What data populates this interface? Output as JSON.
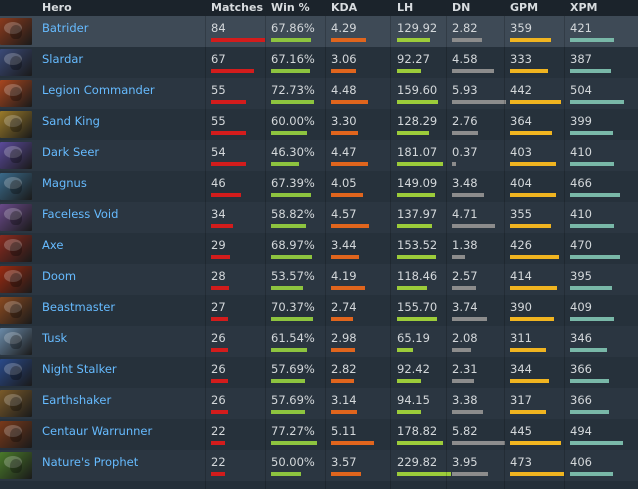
{
  "headers": {
    "hero": "Hero",
    "matches": "Matches",
    "win": "Win %",
    "kda": "KDA",
    "lh": "LH",
    "dn": "DN",
    "gpm": "GPM",
    "xpm": "XPM"
  },
  "colors": {
    "matches_bar": "#d31c1c",
    "win_bar": "#8dc43f",
    "kda_bar": "#e0651d",
    "lh_bar": "#9ccc3a",
    "dn_bar": "#8c8c8c",
    "gpm_bar": "#f0b420",
    "xpm_bar": "#79b8a8",
    "hero_link": "#66bbff"
  },
  "heroes": [
    {
      "name": "Batrider",
      "icon": "batrider-portrait",
      "tint": "#8a3a1c",
      "matches": "84",
      "matches_frac": 1.0,
      "win": "67.86%",
      "win_frac": 0.74,
      "kda": "4.29",
      "kda_frac": 0.64,
      "lh": "129.92",
      "lh_frac": 0.62,
      "dn": "2.82",
      "dn_frac": 0.55,
      "gpm": "359",
      "gpm_frac": 0.76,
      "xpm": "421",
      "xpm_frac": 0.82
    },
    {
      "name": "Slardar",
      "icon": "slardar-portrait",
      "tint": "#3a4a78",
      "matches": "67",
      "matches_frac": 0.8,
      "win": "67.16%",
      "win_frac": 0.73,
      "kda": "3.06",
      "kda_frac": 0.46,
      "lh": "92.27",
      "lh_frac": 0.44,
      "dn": "4.58",
      "dn_frac": 0.78,
      "gpm": "333",
      "gpm_frac": 0.7,
      "xpm": "387",
      "xpm_frac": 0.76
    },
    {
      "name": "Legion Commander",
      "icon": "legion-commander-portrait",
      "tint": "#a8461e",
      "matches": "55",
      "matches_frac": 0.65,
      "win": "72.73%",
      "win_frac": 0.8,
      "kda": "4.48",
      "kda_frac": 0.68,
      "lh": "159.60",
      "lh_frac": 0.76,
      "dn": "5.93",
      "dn_frac": 1.0,
      "gpm": "442",
      "gpm_frac": 0.94,
      "xpm": "504",
      "xpm_frac": 1.0
    },
    {
      "name": "Sand King",
      "icon": "sand-king-portrait",
      "tint": "#9a7a2a",
      "matches": "55",
      "matches_frac": 0.65,
      "win": "60.00%",
      "win_frac": 0.66,
      "kda": "3.30",
      "kda_frac": 0.5,
      "lh": "128.29",
      "lh_frac": 0.6,
      "dn": "2.76",
      "dn_frac": 0.48,
      "gpm": "364",
      "gpm_frac": 0.77,
      "xpm": "399",
      "xpm_frac": 0.79
    },
    {
      "name": "Dark Seer",
      "icon": "dark-seer-portrait",
      "tint": "#5a4a9a",
      "matches": "54",
      "matches_frac": 0.64,
      "win": "46.30%",
      "win_frac": 0.51,
      "kda": "4.47",
      "kda_frac": 0.68,
      "lh": "181.07",
      "lh_frac": 0.86,
      "dn": "0.37",
      "dn_frac": 0.08,
      "gpm": "403",
      "gpm_frac": 0.85,
      "xpm": "410",
      "xpm_frac": 0.81
    },
    {
      "name": "Magnus",
      "icon": "magnus-portrait",
      "tint": "#3a6a8a",
      "matches": "46",
      "matches_frac": 0.55,
      "win": "67.39%",
      "win_frac": 0.74,
      "kda": "4.05",
      "kda_frac": 0.6,
      "lh": "149.09",
      "lh_frac": 0.7,
      "dn": "3.48",
      "dn_frac": 0.6,
      "gpm": "404",
      "gpm_frac": 0.85,
      "xpm": "466",
      "xpm_frac": 0.92
    },
    {
      "name": "Faceless Void",
      "icon": "faceless-void-portrait",
      "tint": "#6a4a8a",
      "matches": "34",
      "matches_frac": 0.4,
      "win": "58.82%",
      "win_frac": 0.65,
      "kda": "4.57",
      "kda_frac": 0.7,
      "lh": "137.97",
      "lh_frac": 0.65,
      "dn": "4.71",
      "dn_frac": 0.8,
      "gpm": "355",
      "gpm_frac": 0.75,
      "xpm": "410",
      "xpm_frac": 0.81
    },
    {
      "name": "Axe",
      "icon": "axe-portrait",
      "tint": "#8a2a1e",
      "matches": "29",
      "matches_frac": 0.35,
      "win": "68.97%",
      "win_frac": 0.76,
      "kda": "3.44",
      "kda_frac": 0.52,
      "lh": "153.52",
      "lh_frac": 0.72,
      "dn": "1.38",
      "dn_frac": 0.24,
      "gpm": "426",
      "gpm_frac": 0.9,
      "xpm": "470",
      "xpm_frac": 0.93
    },
    {
      "name": "Doom",
      "icon": "doom-portrait",
      "tint": "#9a2a10",
      "matches": "28",
      "matches_frac": 0.33,
      "win": "53.57%",
      "win_frac": 0.59,
      "kda": "4.19",
      "kda_frac": 0.63,
      "lh": "118.46",
      "lh_frac": 0.56,
      "dn": "2.57",
      "dn_frac": 0.44,
      "gpm": "414",
      "gpm_frac": 0.87,
      "xpm": "395",
      "xpm_frac": 0.78
    },
    {
      "name": "Beastmaster",
      "icon": "beastmaster-portrait",
      "tint": "#8a4a20",
      "matches": "27",
      "matches_frac": 0.32,
      "win": "70.37%",
      "win_frac": 0.77,
      "kda": "2.74",
      "kda_frac": 0.41,
      "lh": "155.70",
      "lh_frac": 0.74,
      "dn": "3.74",
      "dn_frac": 0.64,
      "gpm": "390",
      "gpm_frac": 0.82,
      "xpm": "409",
      "xpm_frac": 0.81
    },
    {
      "name": "Tusk",
      "icon": "tusk-portrait",
      "tint": "#6a8aa8",
      "matches": "26",
      "matches_frac": 0.31,
      "win": "61.54%",
      "win_frac": 0.67,
      "kda": "2.98",
      "kda_frac": 0.45,
      "lh": "65.19",
      "lh_frac": 0.3,
      "dn": "2.08",
      "dn_frac": 0.36,
      "gpm": "311",
      "gpm_frac": 0.66,
      "xpm": "346",
      "xpm_frac": 0.68
    },
    {
      "name": "Night Stalker",
      "icon": "night-stalker-portrait",
      "tint": "#2a4a8a",
      "matches": "26",
      "matches_frac": 0.31,
      "win": "57.69%",
      "win_frac": 0.63,
      "kda": "2.82",
      "kda_frac": 0.43,
      "lh": "92.42",
      "lh_frac": 0.44,
      "dn": "2.31",
      "dn_frac": 0.4,
      "gpm": "344",
      "gpm_frac": 0.72,
      "xpm": "366",
      "xpm_frac": 0.72
    },
    {
      "name": "Earthshaker",
      "icon": "earthshaker-portrait",
      "tint": "#7a5a2a",
      "matches": "26",
      "matches_frac": 0.31,
      "win": "57.69%",
      "win_frac": 0.63,
      "kda": "3.14",
      "kda_frac": 0.48,
      "lh": "94.15",
      "lh_frac": 0.45,
      "dn": "3.38",
      "dn_frac": 0.58,
      "gpm": "317",
      "gpm_frac": 0.67,
      "xpm": "366",
      "xpm_frac": 0.72
    },
    {
      "name": "Centaur Warrunner",
      "icon": "centaur-warrunner-portrait",
      "tint": "#7a3a1a",
      "matches": "22",
      "matches_frac": 0.26,
      "win": "77.27%",
      "win_frac": 0.85,
      "kda": "5.11",
      "kda_frac": 0.8,
      "lh": "178.82",
      "lh_frac": 0.85,
      "dn": "5.82",
      "dn_frac": 0.98,
      "gpm": "445",
      "gpm_frac": 0.95,
      "xpm": "494",
      "xpm_frac": 0.98
    },
    {
      "name": "Nature's Prophet",
      "icon": "natures-prophet-portrait",
      "tint": "#4a7a2a",
      "matches": "22",
      "matches_frac": 0.26,
      "win": "50.00%",
      "win_frac": 0.55,
      "kda": "3.57",
      "kda_frac": 0.55,
      "lh": "229.82",
      "lh_frac": 1.0,
      "dn": "3.95",
      "dn_frac": 0.67,
      "gpm": "473",
      "gpm_frac": 1.0,
      "xpm": "406",
      "xpm_frac": 0.8
    }
  ]
}
